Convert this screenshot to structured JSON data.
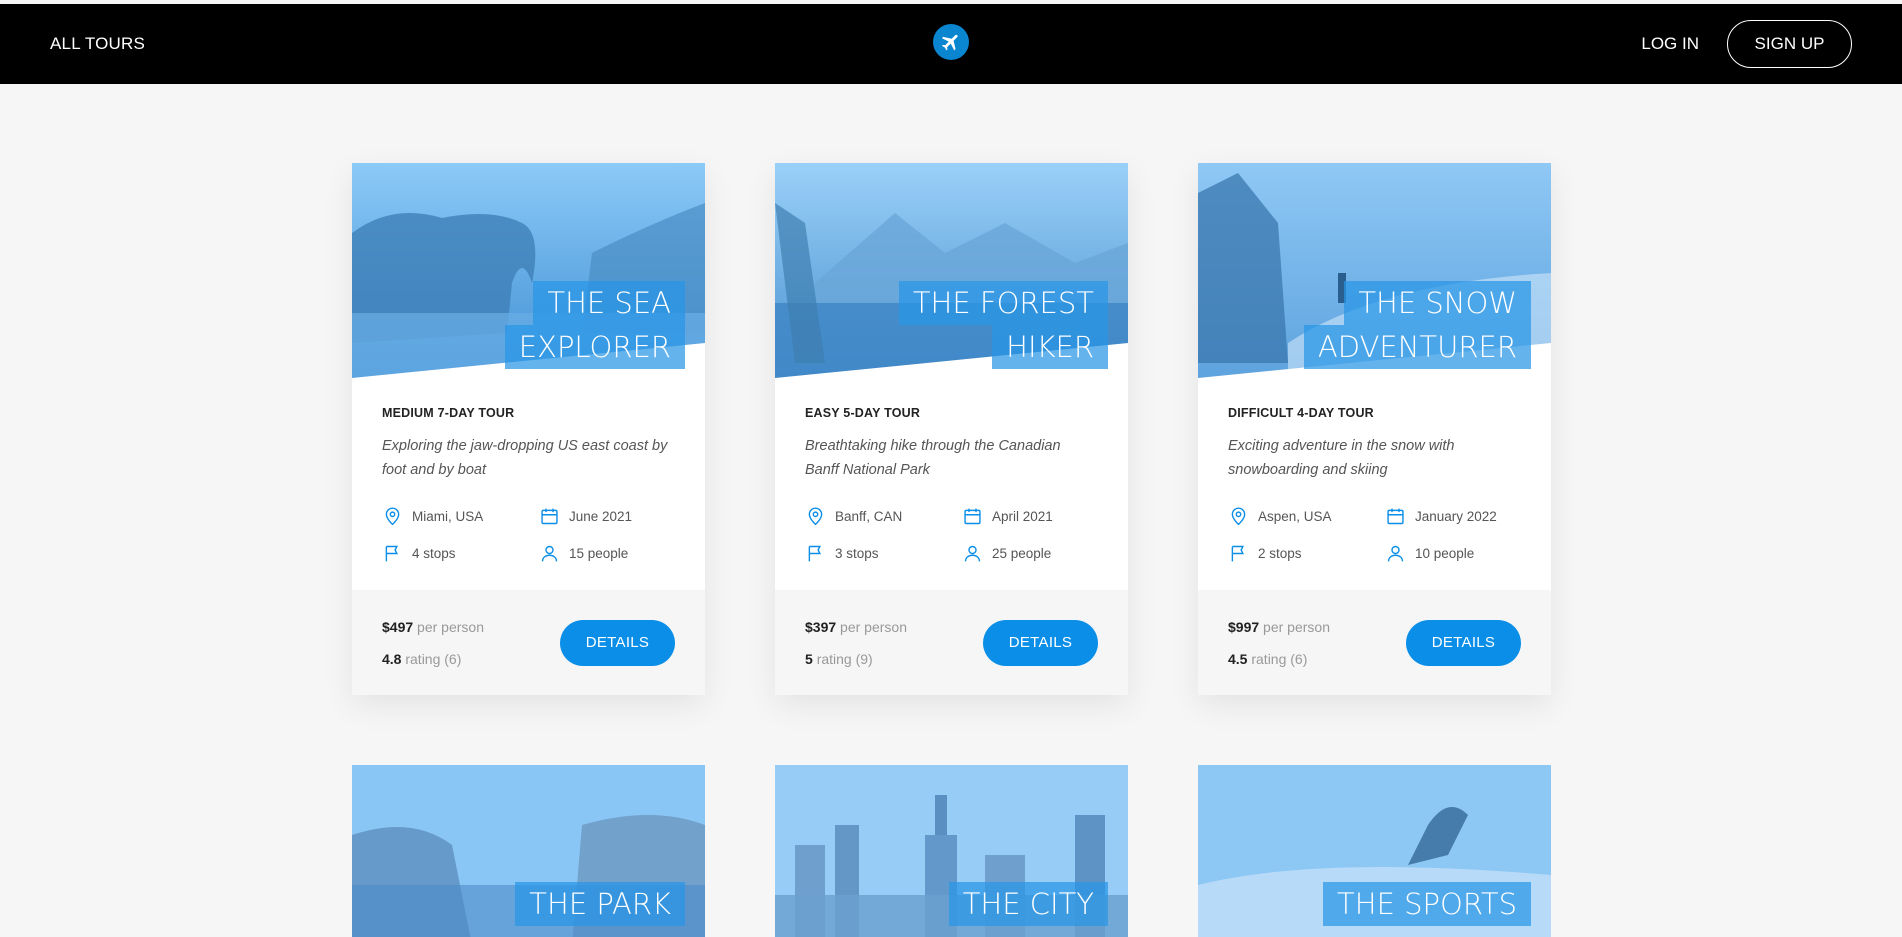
{
  "header": {
    "all_tours": "ALL TOURS",
    "logo_icon": "airplane-icon",
    "login": "LOG IN",
    "signup": "SIGN UP"
  },
  "tours": [
    {
      "title_line1": "THE SEA",
      "title_line2": "EXPLORER",
      "subtitle": "MEDIUM 7-DAY TOUR",
      "summary": "Exploring the jaw-dropping US east coast by foot and by boat",
      "location": "Miami, USA",
      "date": "June 2021",
      "stops": "4 stops",
      "people": "15 people",
      "price": "$497",
      "price_unit": "per person",
      "rating": "4.8",
      "rating_label": "rating (6)",
      "button": "DETAILS"
    },
    {
      "title_line1": "THE FOREST",
      "title_line2": "HIKER",
      "subtitle": "EASY 5-DAY TOUR",
      "summary": "Breathtaking hike through the Canadian Banff National Park",
      "location": "Banff, CAN",
      "date": "April 2021",
      "stops": "3 stops",
      "people": "25 people",
      "price": "$397",
      "price_unit": "per person",
      "rating": "5",
      "rating_label": "rating (9)",
      "button": "DETAILS"
    },
    {
      "title_line1": "THE SNOW",
      "title_line2": "ADVENTURER",
      "subtitle": "DIFFICULT 4-DAY TOUR",
      "summary": "Exciting adventure in the snow with snowboarding and skiing",
      "location": "Aspen, USA",
      "date": "January 2022",
      "stops": "2 stops",
      "people": "10 people",
      "price": "$997",
      "price_unit": "per person",
      "rating": "4.5",
      "rating_label": "rating (6)",
      "button": "DETAILS"
    }
  ],
  "partial_tours": [
    {
      "title_line1": "THE PARK"
    },
    {
      "title_line1": "THE CITY"
    },
    {
      "title_line1": "THE SPORTS"
    }
  ],
  "colors": {
    "accent": "#0a8ee8",
    "header_bg": "#000000",
    "page_bg": "#f6f6f6"
  }
}
